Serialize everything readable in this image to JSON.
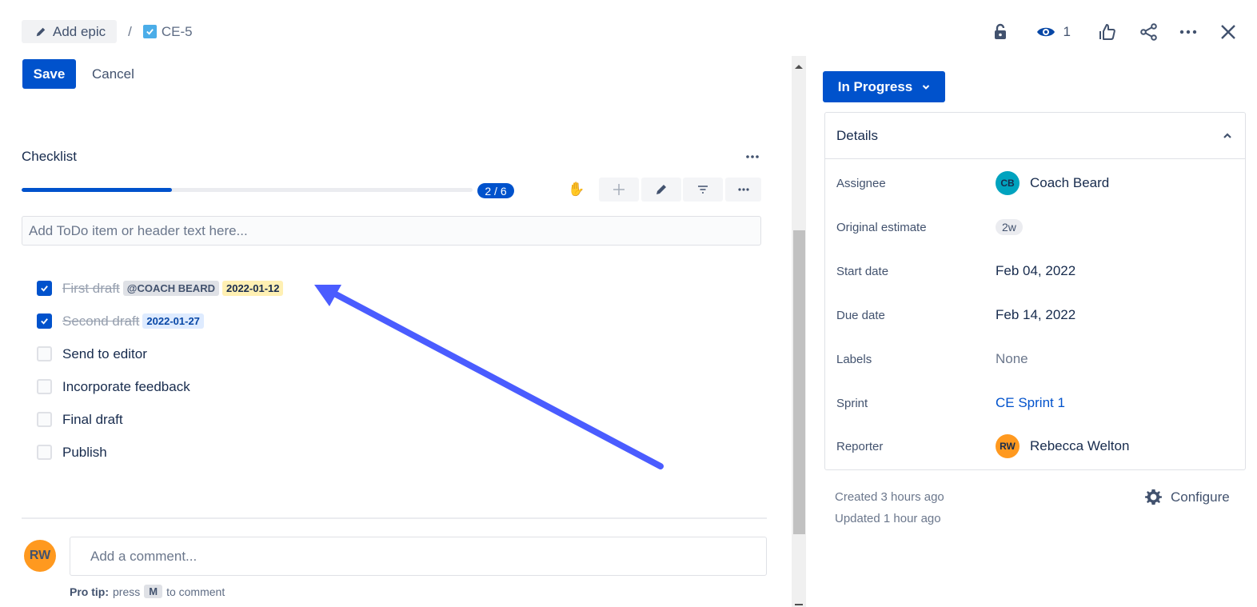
{
  "breadcrumb": {
    "epic_label": "Add epic",
    "separator": "/",
    "issue_key": "CE-5"
  },
  "top_actions": {
    "watch_count": "1"
  },
  "editor": {
    "save_label": "Save",
    "cancel_label": "Cancel"
  },
  "checklist": {
    "title": "Checklist",
    "progress_fraction": 0.333,
    "progress_label": "2 / 6",
    "add_placeholder": "Add ToDo item or header text here...",
    "items": [
      {
        "text": "First draft",
        "checked": true,
        "mention": "@COACH BEARD",
        "date": "2022-01-12"
      },
      {
        "text": "Second draft",
        "checked": true,
        "date": "2022-01-27"
      },
      {
        "text": "Send to editor",
        "checked": false
      },
      {
        "text": "Incorporate feedback",
        "checked": false
      },
      {
        "text": "Final draft",
        "checked": false
      },
      {
        "text": "Publish",
        "checked": false
      }
    ]
  },
  "comment": {
    "avatar_initials": "RW",
    "placeholder": "Add a comment...",
    "pro_tip_label": "Pro tip:",
    "pro_tip_pre": "press",
    "pro_tip_key": "M",
    "pro_tip_post": "to comment"
  },
  "status": {
    "label": "In Progress"
  },
  "details": {
    "title": "Details",
    "assignee_label": "Assignee",
    "assignee_initials": "CB",
    "assignee_name": "Coach Beard",
    "estimate_label": "Original estimate",
    "estimate_value": "2w",
    "start_label": "Start date",
    "start_value": "Feb 04, 2022",
    "due_label": "Due date",
    "due_value": "Feb 14, 2022",
    "labels_label": "Labels",
    "labels_value": "None",
    "sprint_label": "Sprint",
    "sprint_value": "CE Sprint 1",
    "reporter_label": "Reporter",
    "reporter_initials": "RW",
    "reporter_name": "Rebecca Welton"
  },
  "meta": {
    "created": "Created 3 hours ago",
    "updated": "Updated 1 hour ago",
    "configure_label": "Configure"
  },
  "colors": {
    "primary": "#0052cc",
    "annotation_arrow": "#4a5cff",
    "assignee_avatar": "#00a3bf",
    "reporter_avatar": "#ff991f"
  }
}
